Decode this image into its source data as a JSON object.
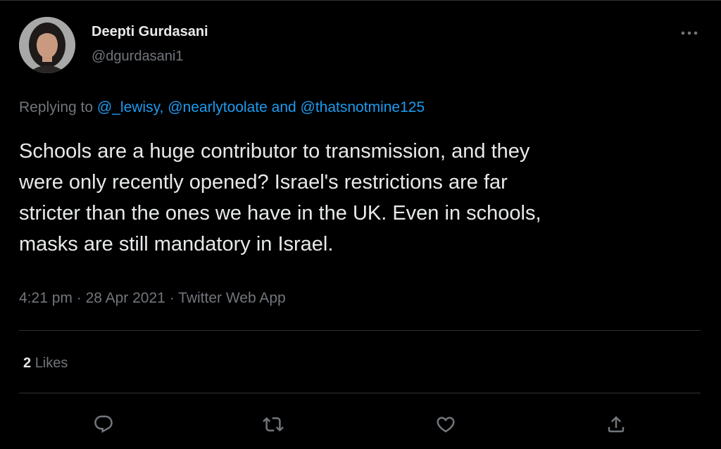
{
  "author": {
    "name": "Deepti Gurdasani",
    "handle": "@dgurdasani1"
  },
  "reply": {
    "prefix": "Replying to",
    "mention_1": "@_lewisy",
    "separator_1": ",",
    "mention_2": "@nearlytoolate",
    "conjunction": "and",
    "mention_3": "@thatsnotmine125"
  },
  "tweet": {
    "lines": [
      "Schools are a huge contributor to transmission, and they",
      "were only recently opened? Israel's restrictions are far",
      "stricter than the ones we have in the UK. Even in schools,",
      "masks are still mandatory in Israel."
    ]
  },
  "meta": {
    "time": "4:21 pm",
    "sep_1": "·",
    "date": "28 Apr 2021",
    "sep_2": "·",
    "app": "Twitter Web App"
  },
  "stats": {
    "likes_count": "2",
    "likes_label": "Likes"
  },
  "icons": {
    "more": "more-horizontal-icon",
    "reply": "reply-icon",
    "retweet": "retweet-icon",
    "like": "heart-icon",
    "share": "share-icon"
  },
  "colors": {
    "background": "#000000",
    "text_primary": "#e7e9ea",
    "text_secondary": "#71767b",
    "link": "#1d9bf0",
    "divider": "#2f3336"
  }
}
